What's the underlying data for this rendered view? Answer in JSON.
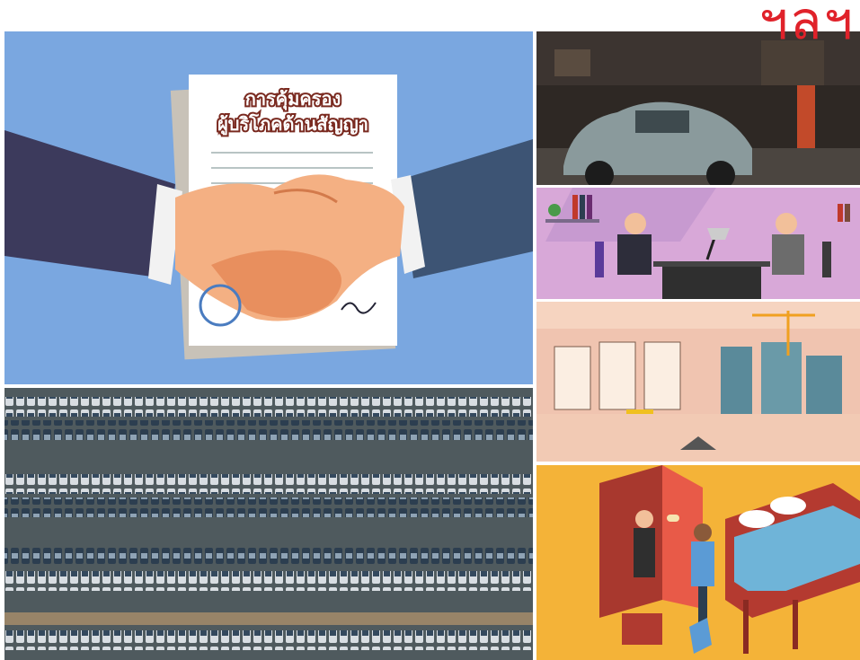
{
  "brand": {
    "logo_text": "ฯลฯ",
    "color": "#e0222a"
  },
  "handshake_panel": {
    "document_title_line1": "การคุ้มครอง",
    "document_title_line2": "ผู้บริโภคด้านสัญญา",
    "background": "#7aa7e0"
  },
  "images": [
    {
      "id": "handshake",
      "icon": "handshake-illustration"
    },
    {
      "id": "garage",
      "icon": "vintage-car-in-garage-photo"
    },
    {
      "id": "office",
      "icon": "business-meeting-illustration"
    },
    {
      "id": "construction",
      "icon": "construction-site-illustration"
    },
    {
      "id": "parking",
      "icon": "aerial-parking-lot-photo"
    },
    {
      "id": "hotel",
      "icon": "hotel-room-check-in-illustration"
    }
  ]
}
